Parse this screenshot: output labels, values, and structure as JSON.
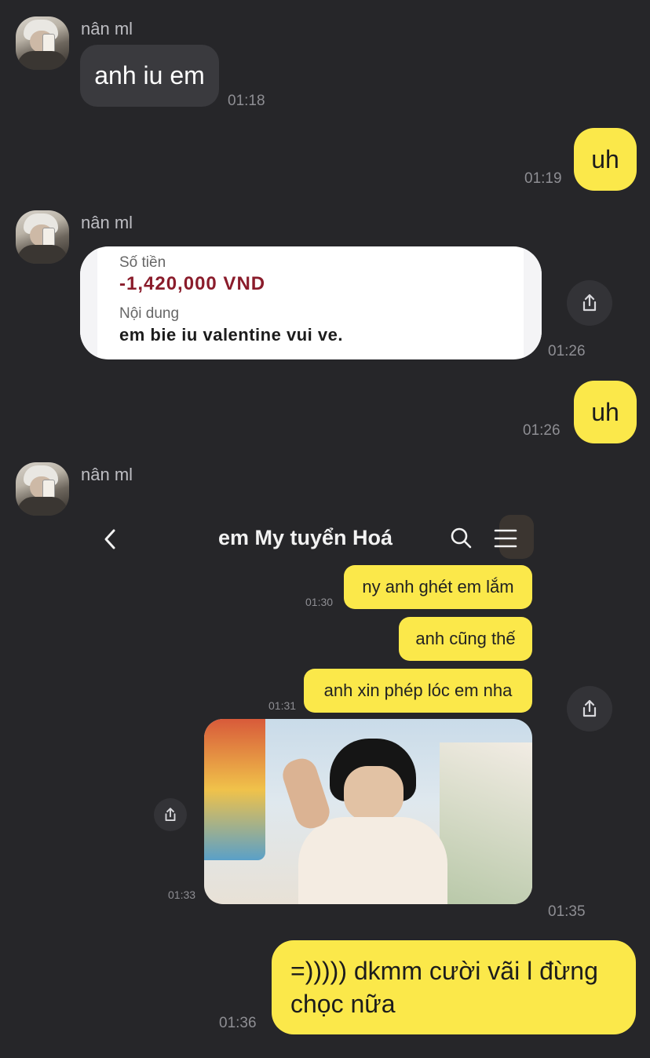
{
  "messages": {
    "m1": {
      "sender": "nân ml",
      "text": "anh iu em",
      "time": "01:18"
    },
    "m2": {
      "text": "uh",
      "time": "01:19"
    },
    "m3": {
      "sender": "nân ml",
      "time": "01:26",
      "transfer": {
        "amount_label": "Số tiền",
        "amount": "-1,420,000 VND",
        "content_label": "Nội dung",
        "content": "em bie iu valentine vui ve."
      }
    },
    "m4": {
      "text": "uh",
      "time": "01:26"
    },
    "m5": {
      "sender": "nân ml",
      "time": "01:35",
      "screenshot": {
        "title": "em My tuyển Hoá",
        "msgs": [
          {
            "text": "ny anh ghét em lắm",
            "time": "01:30"
          },
          {
            "text": "anh cũng thế",
            "time": ""
          },
          {
            "text": "anh xin phép lóc em nha",
            "time": "01:31"
          }
        ],
        "photo_time": "01:33"
      }
    },
    "m6": {
      "text": "=))))) dkmm cười vãi l đừng chọc nữa",
      "time": "01:36"
    }
  },
  "colors": {
    "background": "#262629",
    "incoming_bubble": "#3a3a3e",
    "outgoing_bubble": "#fbe84a",
    "amount": "#8a1c2b"
  },
  "icons": [
    "share-icon",
    "back-chevron-icon",
    "search-icon",
    "menu-icon"
  ]
}
